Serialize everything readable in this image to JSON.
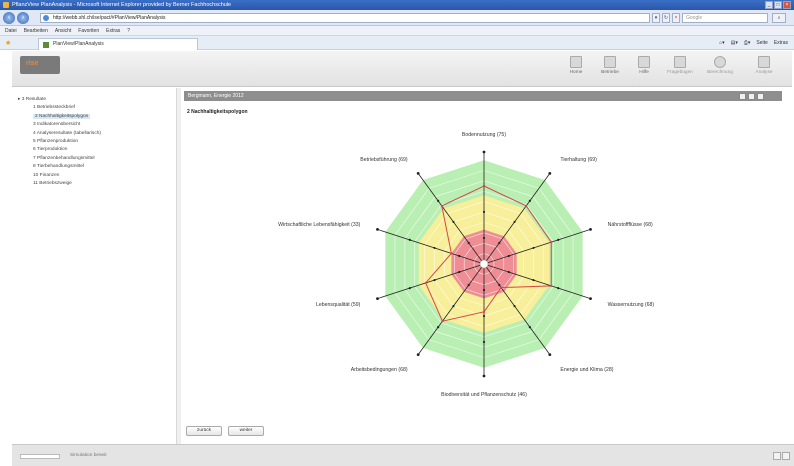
{
  "window": {
    "title": "PflanzView PlanAnalysis - Microsoft Internet Explorer provided by Berner Fachhochschule"
  },
  "address": {
    "url": "http://webb.shl.ch/ise/pact/#PlanView/PlanAnalysis",
    "search_placeholder": "Google"
  },
  "menu": [
    "Datei",
    "Bearbeiten",
    "Ansicht",
    "Favoriten",
    "Extras",
    "?"
  ],
  "tab": {
    "label": "PlanView/PlanAnalysis"
  },
  "ie_tools": {
    "seite": "Seite",
    "extras": "Extras"
  },
  "toolbar": {
    "logo": "rise",
    "items": [
      "Home",
      "Betriebe",
      "Hilfe",
      "Fragebogen",
      "Berechnung",
      "Analyse"
    ]
  },
  "tree": {
    "root": "3 Resultate",
    "items": [
      "1 Betriebssteckbrief",
      "2 Nachhaltigkeitspolygon",
      "3 Indikatorenübersicht",
      "4 Analyseresultate (tabellarisch)",
      "5 Pflanzenproduktion",
      "6 Tierproduktion",
      "7 Pflanzenbehandlungsmittel",
      "8 Tierbehandlungsmittel",
      "10 Finanzen",
      "11 Betriebszweige"
    ],
    "selected_index": 1
  },
  "panel": {
    "header": "Bergmann, Energie 2012",
    "title": "2 Nachhaltigkeitspolygon"
  },
  "buttons": {
    "back": "zurück",
    "next": "weiter"
  },
  "status": {
    "text": "Simulation beseit"
  },
  "colors": {
    "red": "#ee8e94",
    "yellow": "#f8ef9a",
    "green": "#b9efb2",
    "polygon": "#d94545",
    "axis": "#222222"
  },
  "chart_data": {
    "type": "radar",
    "title": "2 Nachhaltigkeitspolygon",
    "max": 100,
    "zones": [
      {
        "name": "red",
        "from": 0,
        "to": 33
      },
      {
        "name": "yellow",
        "from": 33,
        "to": 66
      },
      {
        "name": "green",
        "from": 66,
        "to": 100
      }
    ],
    "categories": [
      "Bodennutzung (75)",
      "Tierhaltung (69)",
      "Nährstoffflüsse (68)",
      "Wassernutzung (68)",
      "Energie und Klima (28)",
      "Biodiversität und Pflanzenschutz (46)",
      "Arbeitsbedingungen (68)",
      "Lebensqualität (59)",
      "Wirtschaftliche Lebensfähigkeit (33)",
      "Betriebsführung (69)"
    ],
    "values": [
      75,
      69,
      68,
      68,
      28,
      46,
      68,
      59,
      33,
      69
    ],
    "grid": true
  }
}
